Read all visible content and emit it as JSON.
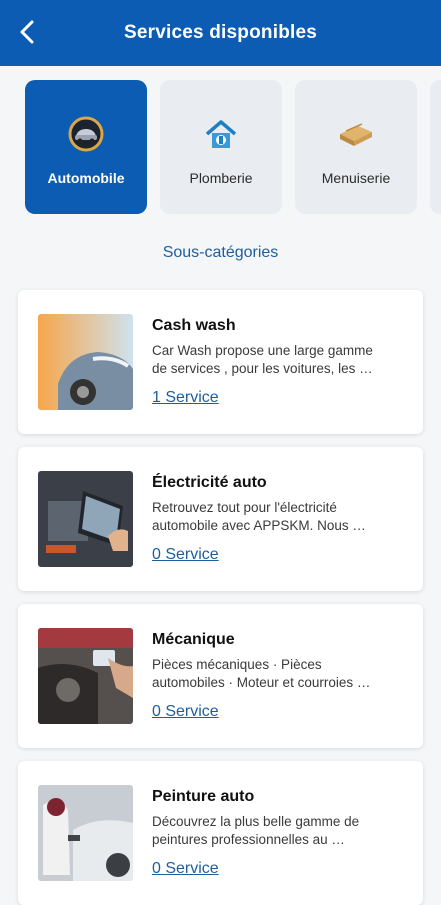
{
  "header": {
    "title": "Services disponibles",
    "back_icon": "arrow-left-icon"
  },
  "categories": [
    {
      "label": "Automobile",
      "icon": "car-wash-icon",
      "active": true
    },
    {
      "label": "Plomberie",
      "icon": "plumbing-house-icon",
      "active": false
    },
    {
      "label": "Menuiserie",
      "icon": "wood-planks-icon",
      "active": false
    }
  ],
  "subcategory_heading": "Sous-catégories",
  "services": [
    {
      "title": "Cash wash",
      "desc_line1": "Car Wash propose une large gamme",
      "desc_line2": "de services , pour les voitures, les …",
      "link": "1 Service"
    },
    {
      "title": "Électricité auto",
      "desc_line1": "Retrouvez tout pour l'électricité",
      "desc_line2": "automobile avec APPSKM. Nous …",
      "link": "0 Service"
    },
    {
      "title": "Mécanique",
      "desc_line1": "Pièces mécaniques · Pièces",
      "desc_line2": "automobiles · Moteur et courroies …",
      "link": "0 Service"
    },
    {
      "title": "Peinture auto",
      "desc_line1": "Découvrez la plus belle gamme de",
      "desc_line2": "peintures professionnelles au …",
      "link": "0 Service"
    }
  ],
  "colors": {
    "primary": "#0d5cb3",
    "link": "#1d5e9f",
    "background": "#f4f6f8"
  }
}
